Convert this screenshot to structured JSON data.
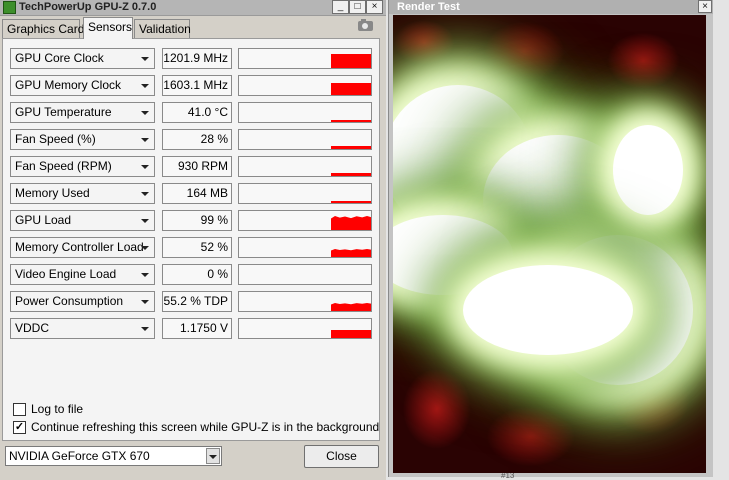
{
  "gpuz": {
    "title": "TechPowerUp GPU-Z 0.7.0",
    "window_buttons": {
      "minimize": "_",
      "maximize": "□",
      "close": "×"
    },
    "tabs": [
      "Graphics Card",
      "Sensors",
      "Validation"
    ],
    "active_tab": "Sensors",
    "sensors": [
      {
        "label": "GPU Core Clock",
        "value": "1201.9 MHz",
        "level": 0.95,
        "spiky": false
      },
      {
        "label": "GPU Memory Clock",
        "value": "1603.1 MHz",
        "level": 0.8,
        "spiky": false
      },
      {
        "label": "GPU Temperature",
        "value": "41.0 °C",
        "level": 0.15,
        "spiky": false
      },
      {
        "label": "Fan Speed (%)",
        "value": "28 %",
        "level": 0.2,
        "spiky": false
      },
      {
        "label": "Fan Speed (RPM)",
        "value": "930 RPM",
        "level": 0.2,
        "spiky": false
      },
      {
        "label": "Memory Used",
        "value": "164 MB",
        "level": 0.12,
        "spiky": false
      },
      {
        "label": "GPU Load",
        "value": "99 %",
        "level": 0.95,
        "spiky": true
      },
      {
        "label": "Memory Controller Load",
        "value": "52 %",
        "level": 0.5,
        "spiky": true
      },
      {
        "label": "Video Engine Load",
        "value": "0 %",
        "level": 0.0,
        "spiky": false
      },
      {
        "label": "Power Consumption",
        "value": "55.2 % TDP",
        "level": 0.55,
        "spiky": true
      },
      {
        "label": "VDDC",
        "value": "1.1750 V",
        "level": 0.55,
        "spiky": false
      }
    ],
    "options": {
      "log_to_file": {
        "label": "Log to file",
        "checked": false
      },
      "continue_refresh": {
        "label": "Continue refreshing this screen while GPU-Z is in the background",
        "checked": true
      }
    },
    "gpu_select": "NVIDIA GeForce GTX 670",
    "close_label": "Close",
    "graph_color": "#ff0000"
  },
  "render_test": {
    "title": "Render Test",
    "close": "×",
    "footer_text": "#13"
  }
}
